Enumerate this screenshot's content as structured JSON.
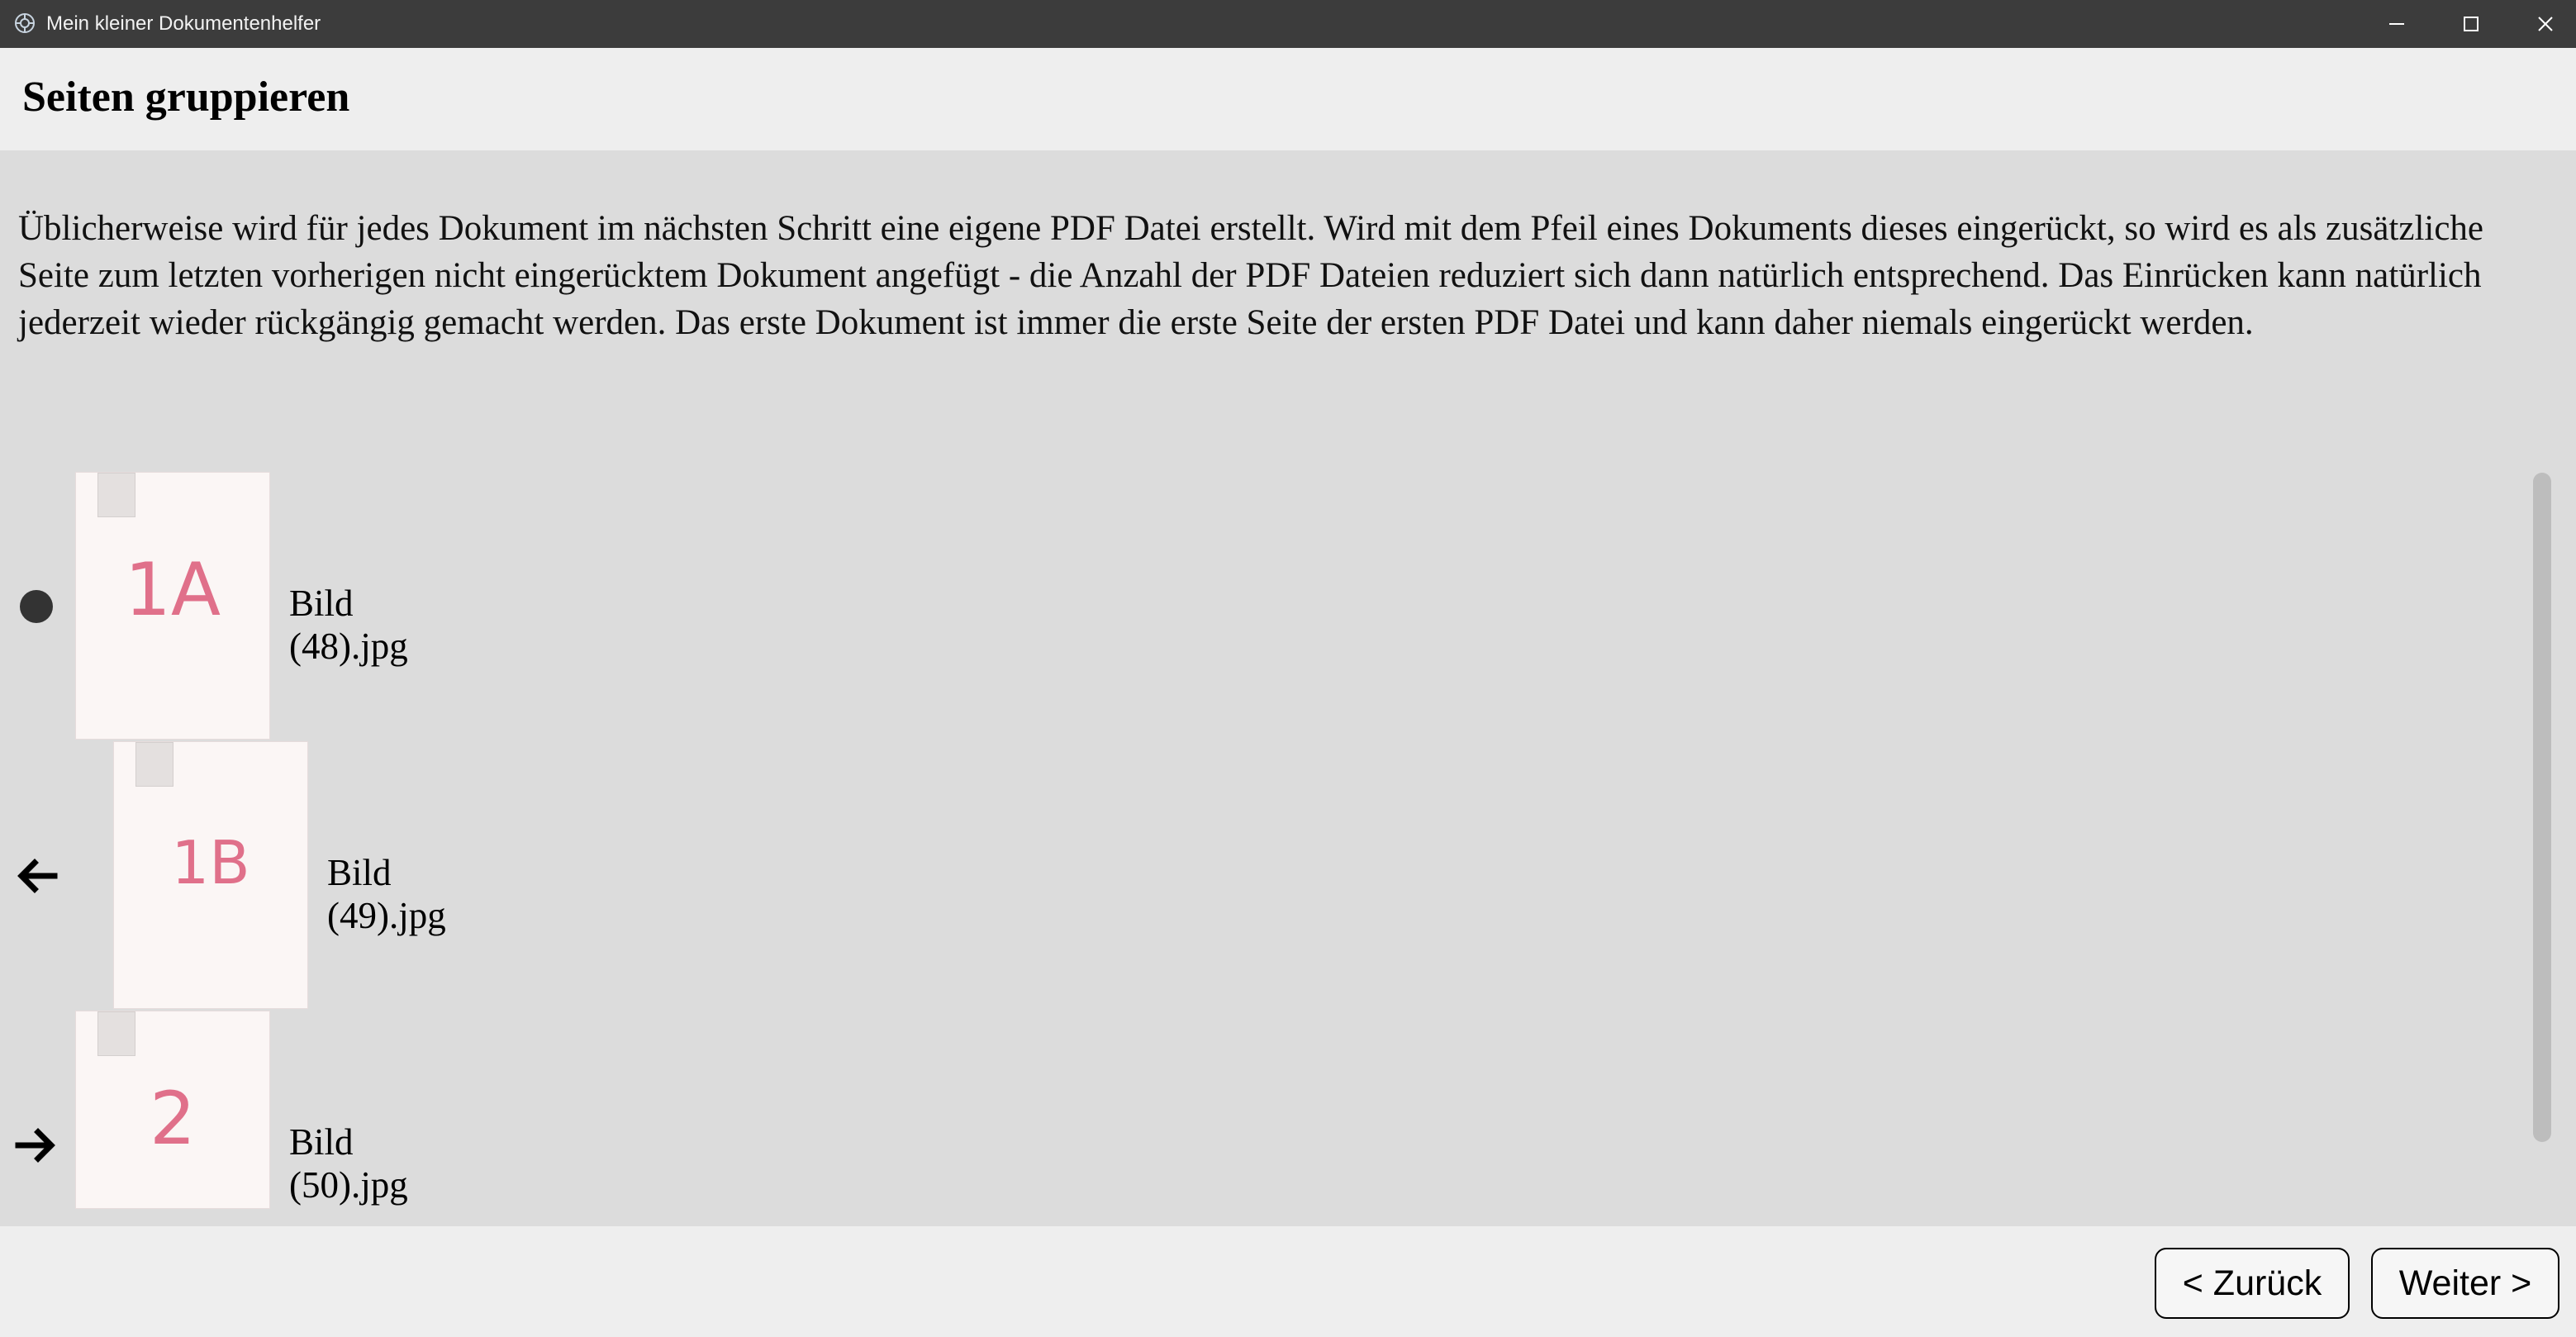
{
  "window": {
    "title": "Mein kleiner Dokumentenhelfer",
    "icon": "app-logo-icon",
    "controls": [
      "minimize-icon",
      "maximize-icon",
      "close-icon"
    ]
  },
  "header": {
    "title": "Seiten gruppieren"
  },
  "description": "Üblicherweise wird für jedes Dokument im nächsten Schritt eine eigene PDF Datei erstellt. Wird mit dem Pfeil eines Dokuments dieses eingerückt, so wird es als zusätzliche Seite zum letzten vorherigen nicht eingerücktem Dokument angefügt - die Anzahl der PDF Dateien reduziert sich dann natürlich entsprechend. Das Einrücken kann natürlich jederzeit wieder rückgängig gemacht werden. Das erste Dokument ist immer die erste Seite der ersten PDF Datei und kann daher niemals eingerückt werden.",
  "documents": [
    {
      "filename": "Bild (48).jpg",
      "thumb_label": "1A",
      "marker": "bullet-icon",
      "indented": false
    },
    {
      "filename": "Bild (49).jpg",
      "thumb_label": "1B",
      "marker": "arrow-left-icon",
      "indented": true
    },
    {
      "filename": "Bild (50).jpg",
      "thumb_label": "2",
      "marker": "arrow-right-icon",
      "indented": false
    }
  ],
  "footer": {
    "back_label": "< Zurück",
    "next_label": "Weiter >"
  },
  "colors": {
    "titlebar": "#3c3c3c",
    "background": "#dcdcdc",
    "header": "#eeeeee",
    "handwriting": "#e0708a"
  }
}
